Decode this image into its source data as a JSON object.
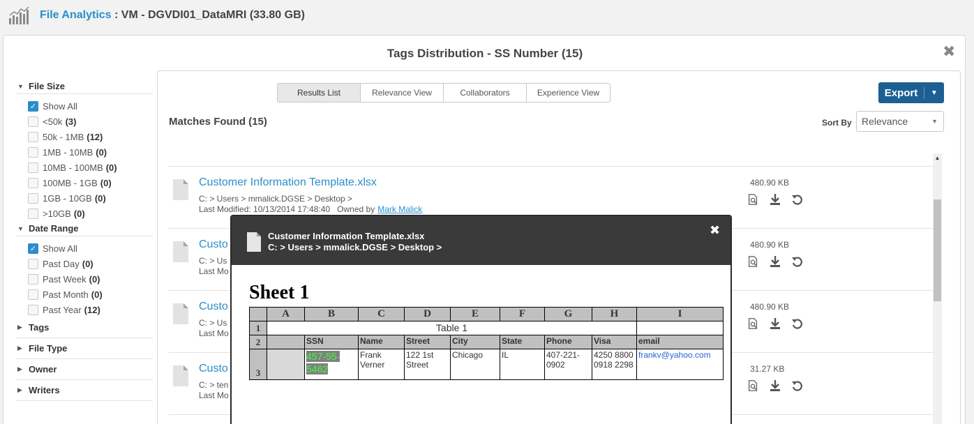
{
  "app": {
    "title_link": "File Analytics",
    "title_rest": " : VM - DGVDI01_DataMRI (33.80 GB)"
  },
  "panel": {
    "title": "Tags Distribution - SS Number (15)",
    "close": "✖"
  },
  "filters": {
    "file_size": {
      "label": "File Size",
      "options": [
        {
          "label": "Show All",
          "count": "",
          "checked": true
        },
        {
          "label": "<50k",
          "count": "(3)",
          "checked": false
        },
        {
          "label": "50k - 1MB",
          "count": "(12)",
          "checked": false
        },
        {
          "label": "1MB - 10MB",
          "count": "(0)",
          "checked": false
        },
        {
          "label": "10MB - 100MB",
          "count": "(0)",
          "checked": false
        },
        {
          "label": "100MB - 1GB",
          "count": "(0)",
          "checked": false
        },
        {
          "label": "1GB - 10GB",
          "count": "(0)",
          "checked": false
        },
        {
          "label": ">10GB",
          "count": "(0)",
          "checked": false
        }
      ]
    },
    "date_range": {
      "label": "Date Range",
      "options": [
        {
          "label": "Show All",
          "count": "",
          "checked": true
        },
        {
          "label": "Past Day",
          "count": "(0)",
          "checked": false
        },
        {
          "label": "Past Week",
          "count": "(0)",
          "checked": false
        },
        {
          "label": "Past Month",
          "count": "(0)",
          "checked": false
        },
        {
          "label": "Past Year",
          "count": "(12)",
          "checked": false
        }
      ]
    },
    "collapsed": [
      "Tags",
      "File Type",
      "Owner",
      "Writers"
    ]
  },
  "tabs": [
    "Results List",
    "Relevance View",
    "Collaborators",
    "Experience View"
  ],
  "active_tab": "Results List",
  "export_label": "Export",
  "matches": "Matches Found (15)",
  "sort": {
    "label": "Sort By",
    "value": "Relevance"
  },
  "rows": [
    {
      "title": "Customer Information Template.xlsx",
      "path": "C: > Users > mmalick.DGSE > Desktop >",
      "modified": "Last Modified: 10/13/2014 17:48:40",
      "owned_by": "Owned by",
      "owner": "Mark Malick",
      "size": "480.90 KB"
    },
    {
      "title": "Custo",
      "path": "C: > Us",
      "modified": "Last Mo",
      "owned_by": "",
      "owner": "",
      "size": "480.90 KB"
    },
    {
      "title": "Custo",
      "path": "C: > Us",
      "modified": "Last Mo",
      "owned_by": "",
      "owner": "",
      "size": "480.90 KB"
    },
    {
      "title": "Custo",
      "path": "C: > ten",
      "modified": "Last Mo",
      "owned_by": "",
      "owner": "",
      "size": "31.27 KB"
    }
  ],
  "modal": {
    "title": "Customer Information Template.xlsx",
    "path": "C: > Users > mmalick.DGSE > Desktop >",
    "close": "✖",
    "sheet_title": "Sheet 1",
    "columns": [
      "A",
      "B",
      "C",
      "D",
      "E",
      "F",
      "G",
      "H",
      "I"
    ],
    "row1_num": "1",
    "table_title": "Table 1",
    "row2_num": "2",
    "headers": [
      "",
      "SSN",
      "Name",
      "Street",
      "City",
      "State",
      "Phone",
      "Visa",
      "email"
    ],
    "row3_num": "3",
    "record": {
      "ssn": "457-55-5462",
      "name": "Frank Verner",
      "street": "122 1st Street",
      "city": "Chicago",
      "state": "IL",
      "phone": "407-221-0902",
      "visa": "4250 8800 0918 2298",
      "email": "frankv@yahoo.com"
    }
  },
  "colors": {
    "link": "#2b8ec9",
    "export": "#1c5f93",
    "modal_header": "#3a3a3a",
    "ssn_highlight_text": "#3dff3d"
  }
}
